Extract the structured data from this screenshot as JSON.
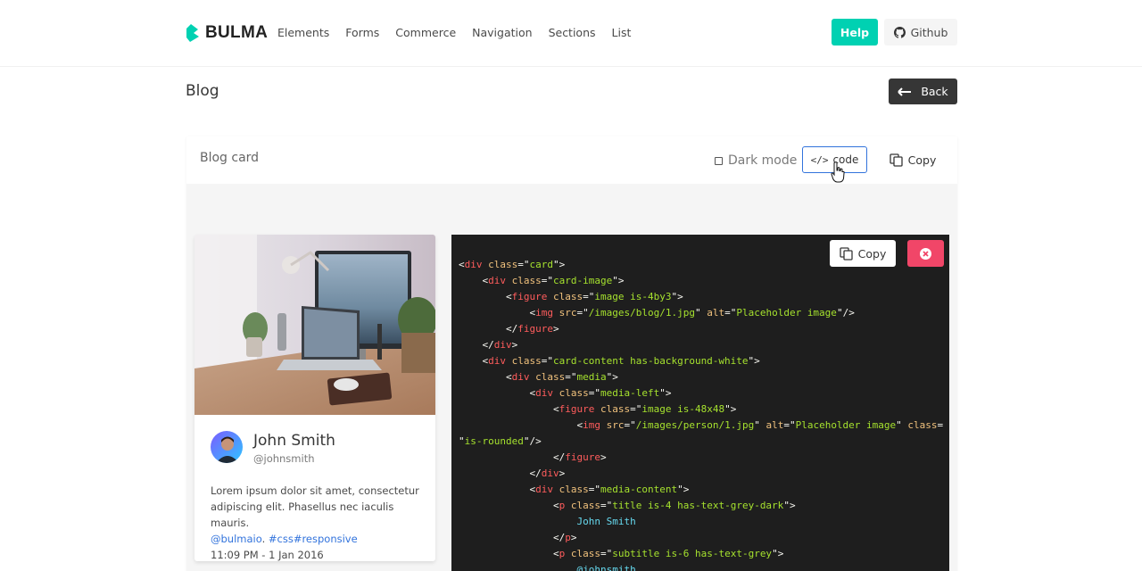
{
  "navbar": {
    "brand": "BULMA",
    "items": [
      {
        "label": "Elements"
      },
      {
        "label": "Forms"
      },
      {
        "label": "Commerce"
      },
      {
        "label": "Navigation"
      },
      {
        "label": "Sections"
      },
      {
        "label": "List"
      }
    ],
    "help_label": "Help",
    "github_label": "Github",
    "accent_color": "#00d1b2"
  },
  "page": {
    "title": "Blog",
    "back_label": "Back"
  },
  "panel": {
    "title": "Blog card",
    "dark_mode_label": "Dark mode",
    "dark_mode_checked": false,
    "code_label": "code",
    "copy_label": "Copy"
  },
  "card": {
    "author_name": "John Smith",
    "author_handle": "@johnsmith",
    "body": "Lorem ipsum dolor sit amet, consectetur adipiscing elit. Phasellus nec iaculis mauris.",
    "mention": "@bulmaio",
    "tags": "#css#responsive",
    "timestamp": "11:09 PM - 1 Jan 2016"
  },
  "code_panel": {
    "copy_label": "Copy",
    "close_color": "#f14668",
    "lines": [
      "<div class=\"card\">",
      "    <div class=\"card-image\">",
      "        <figure class=\"image is-4by3\">",
      "            <img src=\"/images/blog/1.jpg\" alt=\"Placeholder image\"/>",
      "        </figure>",
      "    </div>",
      "    <div class=\"card-content has-background-white\">",
      "        <div class=\"media\">",
      "            <div class=\"media-left\">",
      "                <figure class=\"image is-48x48\">",
      "                    <img src=\"/images/person/1.jpg\" alt=\"Placeholder image\" class=",
      "\"is-rounded\"/>",
      "                </figure>",
      "            </div>",
      "            <div class=\"media-content\">",
      "                <p class=\"title is-4 has-text-grey-dark\">",
      "                    John Smith",
      "                </p>",
      "                <p class=\"subtitle is-6 has-text-grey\">",
      "                    @johnsmith"
    ]
  }
}
